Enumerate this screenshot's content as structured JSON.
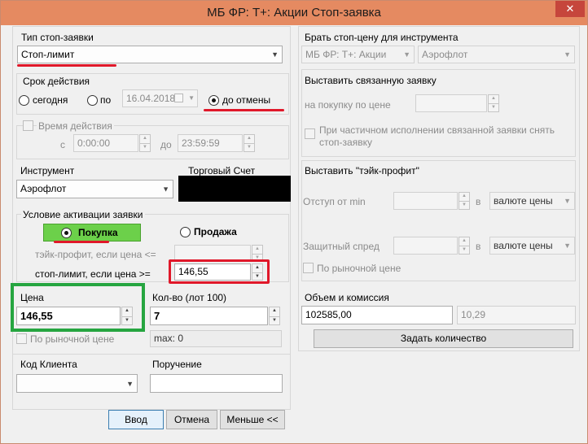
{
  "window": {
    "title": "МБ ФР: Т+: Акции Стоп-заявка",
    "close_glyph": "✕"
  },
  "stop_type": {
    "label": "Тип стоп-заявки",
    "value": "Стоп-лимит"
  },
  "validity": {
    "label": "Срок действия",
    "today": "сегодня",
    "until": "по",
    "date": "16.04.2018",
    "until_cancel": "до отмены",
    "selected": "until_cancel"
  },
  "time_range": {
    "label": "Время действия",
    "from_label": "с",
    "from_value": "0:00:00",
    "to_label": "до",
    "to_value": "23:59:59"
  },
  "instrument": {
    "label": "Инструмент",
    "value": "Аэрофлот"
  },
  "account": {
    "label": "Торговый Счет",
    "value": ""
  },
  "activation": {
    "label": "Условие активации заявки",
    "buy": "Покупка",
    "sell": "Продажа",
    "selected": "buy",
    "take_profit_label": "тэйк-профит, если цена <=",
    "stop_limit_label": "стоп-лимит, если цена >=",
    "stop_limit_value": "146,55"
  },
  "price": {
    "label": "Цена",
    "value": "146,55",
    "market_label": "По рыночной цене"
  },
  "quantity": {
    "label": "Кол-во (лот 100)",
    "value": "7",
    "max": "max: 0"
  },
  "client_code": {
    "label": "Код Клиента",
    "value": ""
  },
  "order_ref": {
    "label": "Поручение",
    "value": ""
  },
  "buttons": {
    "enter": "Ввод",
    "cancel": "Отмена",
    "less": "Меньше <<"
  },
  "stop_price_source": {
    "label": "Брать стоп-цену для инструмента",
    "market": "МБ ФР: Т+: Акции",
    "instrument": "Аэрофлот"
  },
  "linked_order": {
    "label": "Выставить связанную заявку",
    "buy_price_label": "на покупку по цене",
    "partial_label_line1": "При частичном исполнении связанной заявки снять",
    "partial_label_line2": "стоп-заявку"
  },
  "take_profit": {
    "label": "Выставить \"тэйк-профит\"",
    "offset_label": "Отступ от min",
    "spread_label": "Защитный спред",
    "in_label": "в",
    "unit": "валюте цены",
    "market_label": "По рыночной цене"
  },
  "volume": {
    "label": "Объем и комиссия",
    "amount": "102585,00",
    "commission": "10,29",
    "set_qty_button": "Задать количество"
  }
}
